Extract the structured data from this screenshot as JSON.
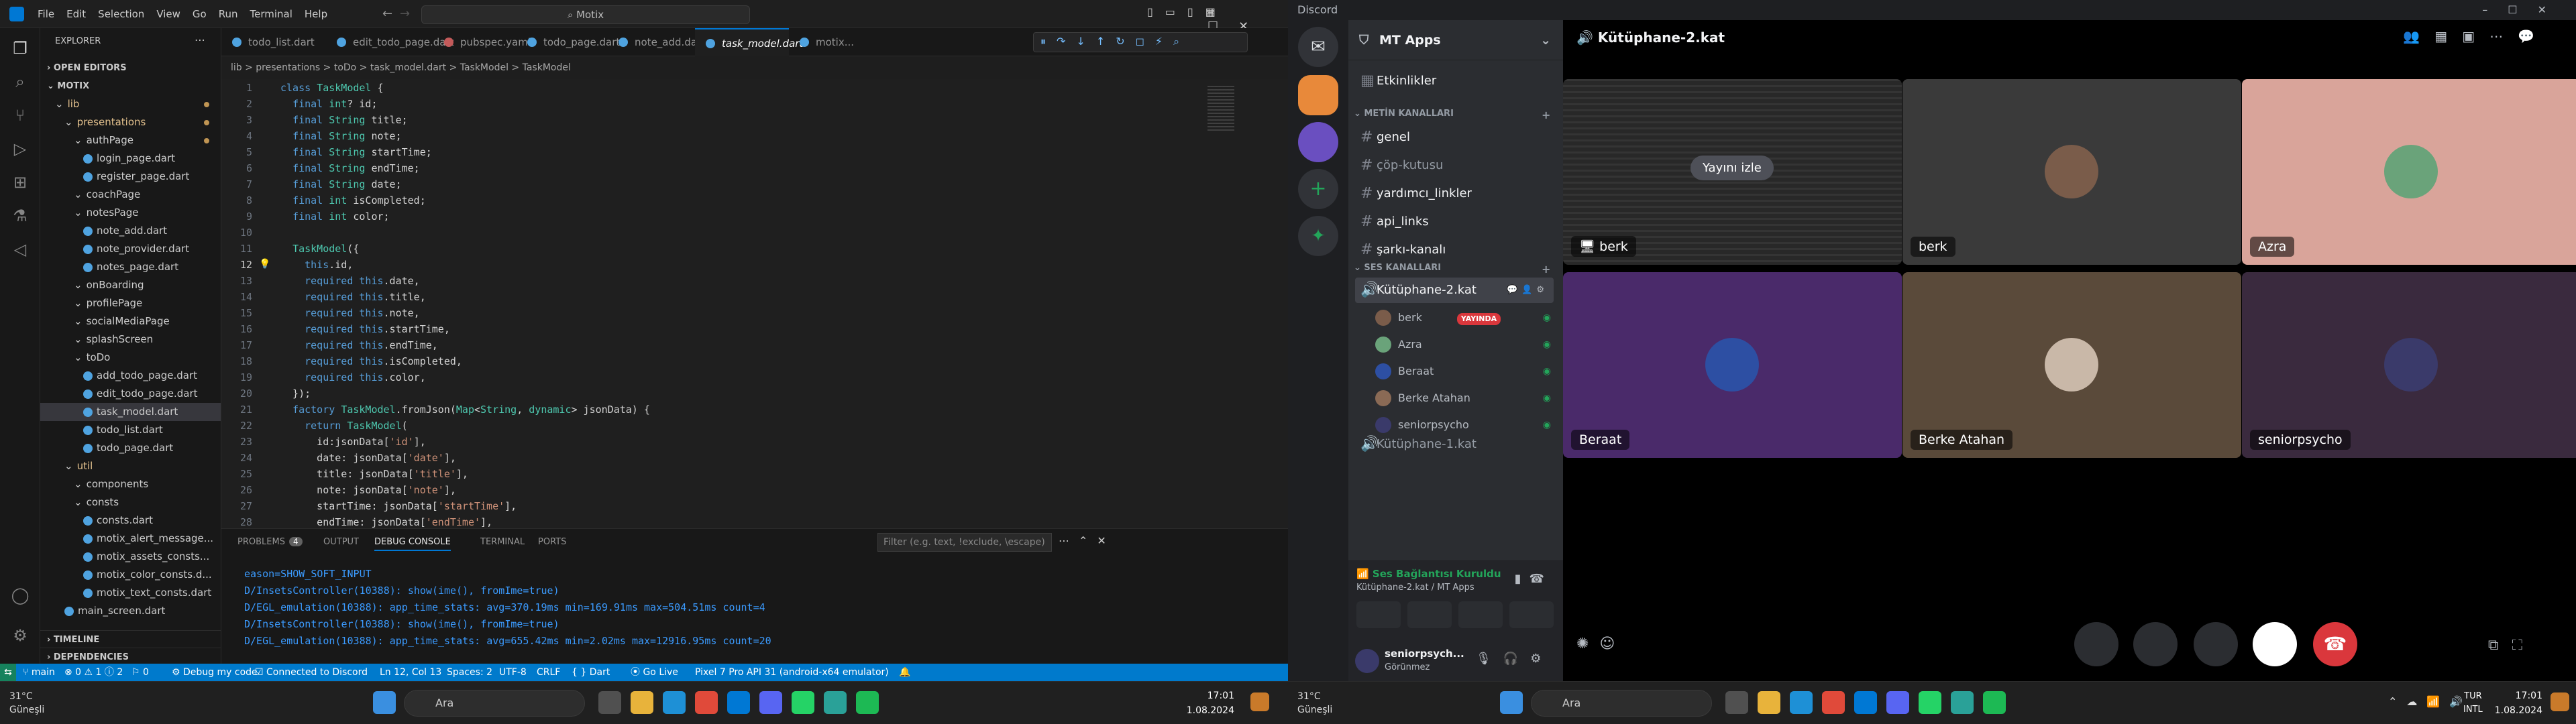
{
  "vscode": {
    "menu": [
      "File",
      "Edit",
      "Selection",
      "View",
      "Go",
      "Run",
      "Terminal",
      "Help"
    ],
    "command_center": "Motix",
    "explorer": {
      "header": "EXPLORER",
      "open_editors": "OPEN EDITORS",
      "project": "MOTIX",
      "tree": [
        {
          "label": "lib",
          "indent": 1,
          "type": "folder"
        },
        {
          "label": "presentations",
          "indent": 2,
          "type": "folder"
        },
        {
          "label": "authPage",
          "indent": 3,
          "type": "folder"
        },
        {
          "label": "login_page.dart",
          "indent": 4,
          "type": "file"
        },
        {
          "label": "register_page.dart",
          "indent": 4,
          "type": "file"
        },
        {
          "label": "coachPage",
          "indent": 3,
          "type": "folder"
        },
        {
          "label": "notesPage",
          "indent": 3,
          "type": "folder"
        },
        {
          "label": "note_add.dart",
          "indent": 4,
          "type": "file"
        },
        {
          "label": "note_provider.dart",
          "indent": 4,
          "type": "file"
        },
        {
          "label": "notes_page.dart",
          "indent": 4,
          "type": "file"
        },
        {
          "label": "onBoarding",
          "indent": 3,
          "type": "folder"
        },
        {
          "label": "profilePage",
          "indent": 3,
          "type": "folder"
        },
        {
          "label": "socialMediaPage",
          "indent": 3,
          "type": "folder"
        },
        {
          "label": "splashScreen",
          "indent": 3,
          "type": "folder"
        },
        {
          "label": "toDo",
          "indent": 3,
          "type": "folder"
        },
        {
          "label": "add_todo_page.dart",
          "indent": 4,
          "type": "file"
        },
        {
          "label": "edit_todo_page.dart",
          "indent": 4,
          "type": "file"
        },
        {
          "label": "task_model.dart",
          "indent": 4,
          "type": "file",
          "selected": true
        },
        {
          "label": "todo_list.dart",
          "indent": 4,
          "type": "file"
        },
        {
          "label": "todo_page.dart",
          "indent": 4,
          "type": "file"
        },
        {
          "label": "util",
          "indent": 2,
          "type": "folder"
        },
        {
          "label": "components",
          "indent": 3,
          "type": "folder"
        },
        {
          "label": "consts",
          "indent": 3,
          "type": "folder"
        },
        {
          "label": "consts.dart",
          "indent": 4,
          "type": "file"
        },
        {
          "label": "motix_alert_message...",
          "indent": 4,
          "type": "file"
        },
        {
          "label": "motix_assets_consts...",
          "indent": 4,
          "type": "file"
        },
        {
          "label": "motix_color_consts.d...",
          "indent": 4,
          "type": "file"
        },
        {
          "label": "motix_text_consts.dart",
          "indent": 4,
          "type": "file"
        },
        {
          "label": "main_screen.dart",
          "indent": 2,
          "type": "file"
        }
      ],
      "timeline": "TIMELINE",
      "dependencies": "DEPENDENCIES"
    },
    "tabs": [
      "todo_list.dart",
      "edit_todo_page.dart",
      "pubspec.yaml",
      "todo_page.dart",
      "note_add.dart",
      "task_model.dart",
      "motix..."
    ],
    "active_tab": "task_model.dart",
    "breadcrumb": "lib > presentations > toDo > task_model.dart > TaskModel > TaskModel",
    "code_lines": [
      "class TaskModel {",
      "  final int? id;",
      "  final String title;",
      "  final String note;",
      "  final String startTime;",
      "  final String endTime;",
      "  final String date;",
      "  final int isCompleted;",
      "  final int color;",
      "",
      "  TaskModel({",
      "    this.id,",
      "    required this.date,",
      "    required this.title,",
      "    required this.note,",
      "    required this.startTime,",
      "    required this.endTime,",
      "    required this.isCompleted,",
      "    required this.color,",
      "  });",
      "  factory TaskModel.fromJson(Map<String, dynamic> jsonData) {",
      "    return TaskModel(",
      "      id:jsonData['id'],",
      "      date: jsonData['date'],",
      "      title: jsonData['title'],",
      "      note: jsonData['note'],",
      "      startTime: jsonData['startTime'],",
      "      endTime: jsonData['endTime'],"
    ],
    "panel_tabs": [
      "PROBLEMS",
      "OUTPUT",
      "DEBUG CONSOLE",
      "TERMINAL",
      "PORTS"
    ],
    "problems_count": "4",
    "filter_placeholder": "Filter (e.g. text, !exclude, \\escape)",
    "console_lines": [
      "eason=SHOW_SOFT_INPUT",
      "D/InsetsController(10388): show(ime(), fromIme=true)",
      "D/EGL_emulation(10388): app_time_stats: avg=370.19ms min=169.91ms max=504.51ms count=4",
      "D/InsetsController(10388): show(ime(), fromIme=true)",
      "D/EGL_emulation(10388): app_time_stats: avg=655.42ms min=2.02ms max=12916.95ms count=20"
    ],
    "status": {
      "branch": "main",
      "problems": "⊗ 0 ⚠ 1 ⓘ 2",
      "ports": "0",
      "debug_mode": "Debug my code",
      "discord": "Connected to Discord",
      "position": "Ln 12, Col 13",
      "spaces": "Spaces: 2",
      "encoding": "UTF-8",
      "eol": "CRLF",
      "language": "Dart",
      "golive": "Go Live",
      "device": "Pixel 7 Pro API 31 (android-x64 emulator)"
    }
  },
  "discord": {
    "app_title": "Discord",
    "server_name": "MT Apps",
    "events": "Etkinlikler",
    "text_category": "METİN KANALLARI",
    "text_channels": [
      "genel",
      "çöp-kutusu",
      "yardımcı_linkler",
      "api_links",
      "şarkı-kanalı"
    ],
    "voice_category": "SES KANALLARI",
    "voice_channel_active": "Kütüphane-2.kat",
    "voice_users": [
      {
        "name": "berk",
        "live": "YAYINDA",
        "color": "#7a5c4a"
      },
      {
        "name": "Azra",
        "color": "#6aa37a"
      },
      {
        "name": "Beraat",
        "color": "#2d4fa3"
      },
      {
        "name": "Berke Atahan",
        "color": "#8a6a55"
      },
      {
        "name": "seniorpsycho",
        "color": "#3a3a6a"
      }
    ],
    "voice_channel_2": "Kütüphane-1.kat",
    "connection_status": "Ses Bağlantısı Kuruldu",
    "connection_sub": "Kütüphane-2.kat / MT Apps",
    "user": {
      "name": "seniorpsych...",
      "status": "Görünmez"
    },
    "stage_title": "Kütüphane-2.kat",
    "watch_stream": "Yayını izle",
    "tiles": [
      {
        "name": "berk",
        "bg": "#2a2a2a",
        "type": "stream"
      },
      {
        "name": "berk",
        "bg": "#3a3a3a",
        "avatar": "#7a5c4a"
      },
      {
        "name": "Azra",
        "bg": "#d9a49a",
        "avatar": "#6aa37a"
      },
      {
        "name": "Beraat",
        "bg": "#4a2a6a",
        "avatar": "#2d4fa3"
      },
      {
        "name": "Berke Atahan",
        "bg": "#5a4a3a",
        "avatar": "#c9b8a8"
      },
      {
        "name": "seniorpsycho",
        "bg": "#3a2a3e",
        "avatar": "#3a3a6a"
      }
    ]
  },
  "taskbar": {
    "weather_temp": "31°C",
    "weather_desc": "Güneşli",
    "search": "Ara",
    "time": "17:01",
    "date": "1.08.2024",
    "lang": "TUR",
    "layout": "INTL"
  },
  "colors": {
    "accent": "#0078d4",
    "status": "#007acc",
    "discord_green": "#23a55a",
    "discord_red": "#da373c"
  }
}
